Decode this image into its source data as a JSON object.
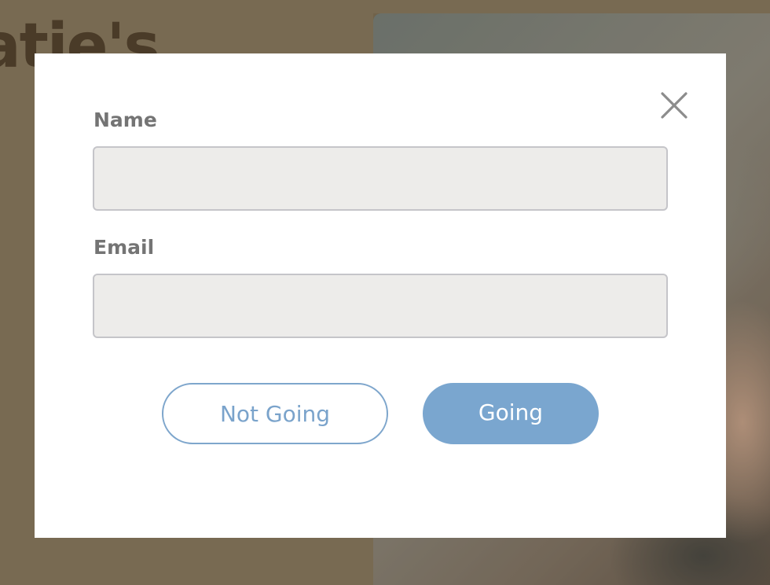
{
  "background": {
    "title_fragment": "atie's"
  },
  "modal": {
    "close_icon": "close-icon",
    "fields": {
      "name": {
        "label": "Name",
        "value": "",
        "placeholder": ""
      },
      "email": {
        "label": "Email",
        "value": "",
        "placeholder": ""
      }
    },
    "buttons": {
      "not_going": "Not Going",
      "going": "Going"
    }
  },
  "colors": {
    "accent": "#7aa6cf",
    "label": "#747474",
    "input_bg": "#edecea",
    "backdrop": "#786a52"
  }
}
